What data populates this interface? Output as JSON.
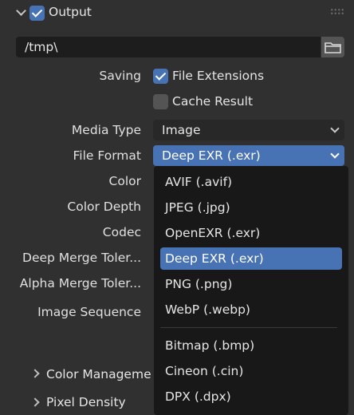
{
  "panel": {
    "title": "Output",
    "path_value": "/tmp\\",
    "saving_label": "Saving",
    "file_extensions_label": "File Extensions",
    "file_extensions_checked": true,
    "cache_result_label": "Cache Result",
    "cache_result_checked": false,
    "media_type_label": "Media Type",
    "media_type_value": "Image",
    "file_format_label": "File Format",
    "file_format_value": "Deep EXR (.exr)",
    "color_label": "Color",
    "color_depth_label": "Color Depth",
    "codec_label": "Codec",
    "deep_merge_label": "Deep Merge Toler...",
    "alpha_merge_label": "Alpha Merge Toler...",
    "image_sequence_label": "Image Sequence",
    "color_management_label": "Color Manageme",
    "pixel_density_label": "Pixel Density"
  },
  "menu": {
    "items": [
      {
        "label": "AVIF (.avif)"
      },
      {
        "label": "JPEG (.jpg)"
      },
      {
        "label": "OpenEXR (.exr)"
      },
      {
        "label": "Deep EXR (.exr)",
        "selected": true
      },
      {
        "label": "PNG (.png)"
      },
      {
        "label": "WebP (.webp)"
      },
      {
        "label": "Bitmap (.bmp)"
      },
      {
        "label": "Cineon (.cin)"
      },
      {
        "label": "DPX (.dpx)"
      }
    ]
  },
  "colors": {
    "background": "#303030",
    "field": "#282828",
    "accent": "#4772b3",
    "menu": "#181818"
  }
}
